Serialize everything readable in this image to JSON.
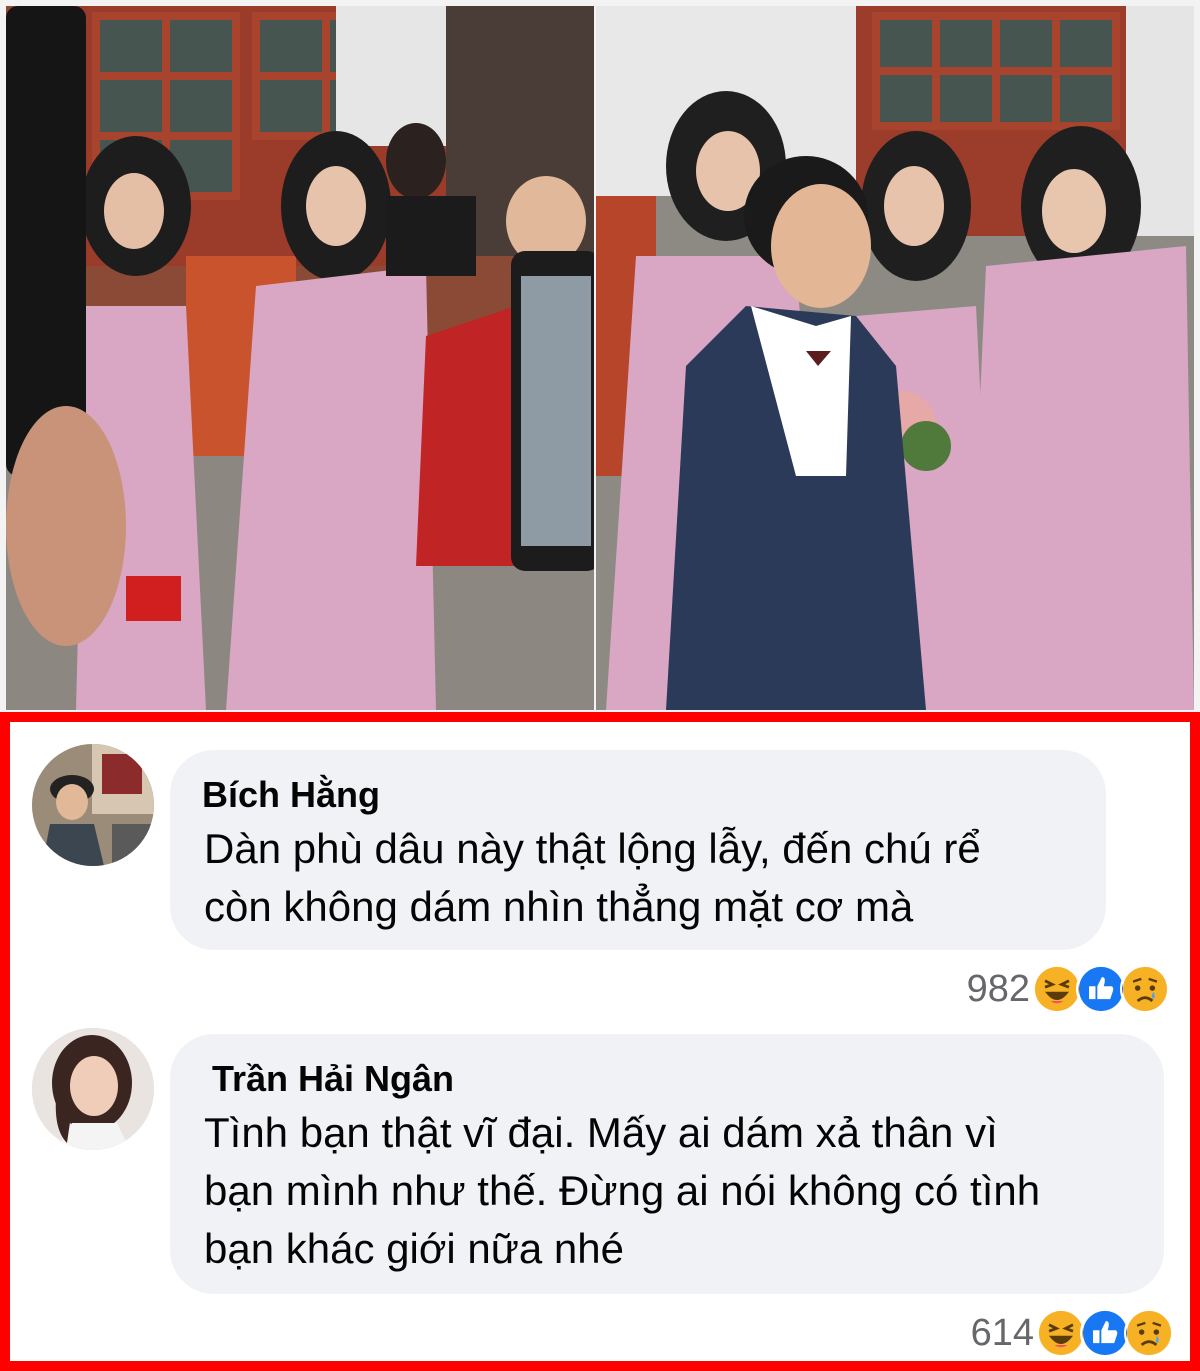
{
  "photos": [
    {
      "name": "wedding-photo-left"
    },
    {
      "name": "wedding-photo-right"
    }
  ],
  "comments": [
    {
      "author": "Bích Hằng",
      "text_lines": [
        "Dàn phù dâu này thật lộng lẫy, đến chú rể",
        "còn không dám nhìn thẳng mặt cơ mà"
      ],
      "reaction_count": "982",
      "reactions": [
        "haha-icon",
        "like-icon",
        "sad-icon"
      ]
    },
    {
      "author": "Trần Hải Ngân",
      "text_lines": [
        "Tình bạn thật vĩ đại. Mấy ai dám xả thân vì",
        "bạn mình như thế. Đừng ai nói không có tình",
        "bạn khác giới nữa nhé"
      ],
      "reaction_count": "614",
      "reactions": [
        "haha-icon",
        "like-icon",
        "sad-icon"
      ]
    }
  ],
  "colors": {
    "highlight_border": "#ff0000",
    "bubble_bg": "#f0f2f5",
    "like_blue": "#1877f2",
    "emoji_yellow": "#f7b125",
    "dress_pink": "#d9a6c4"
  }
}
